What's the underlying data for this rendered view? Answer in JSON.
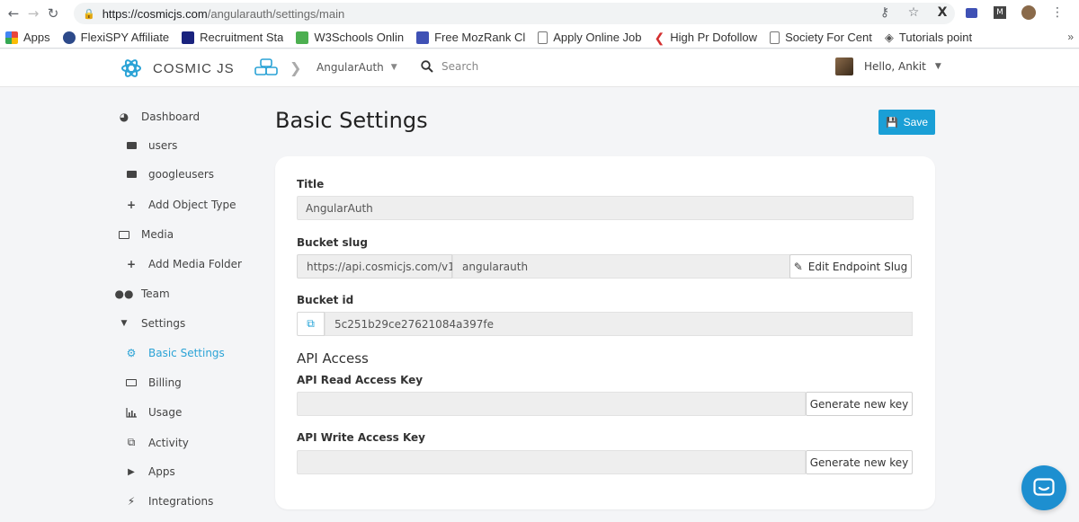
{
  "browser": {
    "url_host": "https://cosmicjs.com",
    "url_path": "/angularauth/settings/main"
  },
  "bookmarks": [
    {
      "label": "Apps",
      "color": "#e8453c"
    },
    {
      "label": "FlexiSPY Affiliate",
      "color": "#2d4a8a"
    },
    {
      "label": "Recruitment Sta",
      "color": "#1a237e"
    },
    {
      "label": "W3Schools Onlin",
      "color": "#4caf50"
    },
    {
      "label": "Free MozRank Cl",
      "color": "#3f51b5"
    },
    {
      "label": "Apply Online Job",
      "color": "#9e9e9e"
    },
    {
      "label": "High Pr Dofollow",
      "color": "#d32f2f"
    },
    {
      "label": "Society For Cent",
      "color": "#9e9e9e"
    },
    {
      "label": "Tutorials point",
      "color": "#555555"
    }
  ],
  "header": {
    "logo_text": "COSMIC JS",
    "bucket_name": "AngularAuth",
    "search_label": "Search",
    "greeting": "Hello, Ankit"
  },
  "sidebar": {
    "items": [
      {
        "label": "Dashboard",
        "icon": "dashboard-icon"
      },
      {
        "label": "users",
        "icon": "folder-icon"
      },
      {
        "label": "googleusers",
        "icon": "folder-icon"
      },
      {
        "label": "Add Object Type",
        "icon": "plus-icon"
      },
      {
        "label": "Media",
        "icon": "image-icon"
      },
      {
        "label": "Add Media Folder",
        "icon": "plus-icon"
      },
      {
        "label": "Team",
        "icon": "users-icon"
      },
      {
        "label": "Settings",
        "icon": "caret-down-icon"
      },
      {
        "label": "Basic Settings",
        "icon": "gear-icon"
      },
      {
        "label": "Billing",
        "icon": "money-icon"
      },
      {
        "label": "Usage",
        "icon": "bar-chart-icon"
      },
      {
        "label": "Activity",
        "icon": "copy-icon"
      },
      {
        "label": "Apps",
        "icon": "play-icon"
      },
      {
        "label": "Integrations",
        "icon": "plug-icon"
      }
    ]
  },
  "main": {
    "title": "Basic Settings",
    "save_label": "Save",
    "title_field": {
      "label": "Title",
      "value": "AngularAuth"
    },
    "slug_field": {
      "label": "Bucket slug",
      "prefix": "https://api.cosmicjs.com/v1/",
      "value": "angularauth",
      "edit_label": "Edit Endpoint Slug"
    },
    "id_field": {
      "label": "Bucket id",
      "value": "5c251b29ce27621084a397fe"
    },
    "api_section": "API Access",
    "read_key": {
      "label": "API Read Access Key",
      "button": "Generate new key"
    },
    "write_key": {
      "label": "API Write Access Key",
      "button": "Generate new key"
    }
  },
  "colors": {
    "accent": "#1a9fd6",
    "active_nav": "#2ba3d6"
  }
}
